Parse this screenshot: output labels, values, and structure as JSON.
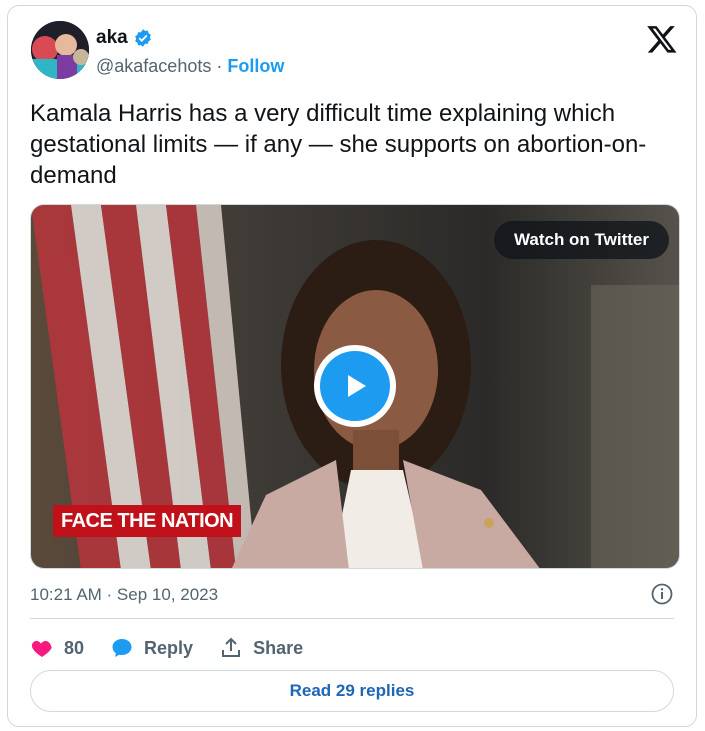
{
  "author": {
    "name": "aka",
    "handle": "@akafacehots",
    "separator": " · ",
    "follow_label": "Follow"
  },
  "tweet": {
    "text": "Kamala Harris has a very difficult time explaining which gestational limits — if any — she supports on abortion-on-demand"
  },
  "media": {
    "watch_label": "Watch on Twitter",
    "network_logo_text": "FACE THE NATION"
  },
  "meta": {
    "timestamp": "10:21 AM · Sep 10, 2023"
  },
  "actions": {
    "like_count": "80",
    "reply_label": "Reply",
    "share_label": "Share"
  },
  "footer": {
    "read_replies_label": "Read 29 replies"
  },
  "colors": {
    "accent": "#1d9bf0",
    "like": "#f91880",
    "text": "#0f1419",
    "muted": "#536471"
  },
  "icons": [
    "verified-badge-icon",
    "x-logo-icon",
    "play-icon",
    "info-icon",
    "heart-icon",
    "reply-bubble-icon",
    "share-icon"
  ]
}
